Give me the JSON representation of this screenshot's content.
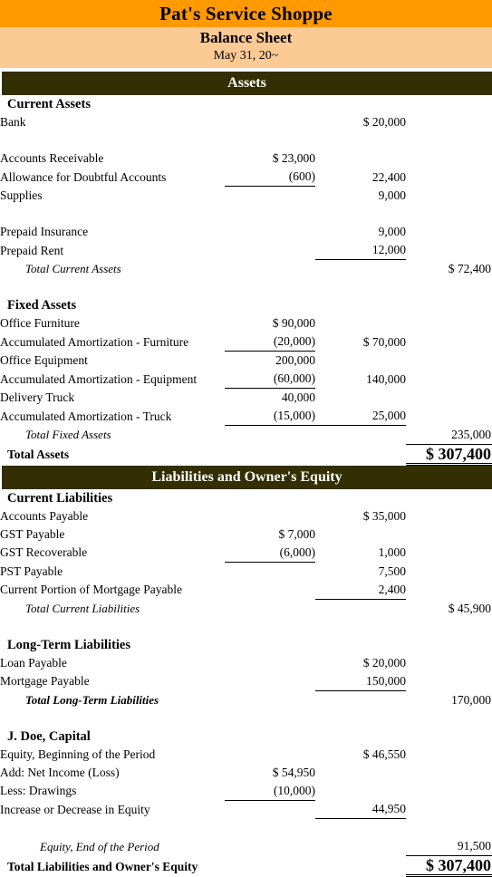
{
  "header": {
    "company": "Pat's Service Shoppe",
    "statement": "Balance Sheet",
    "date": "May 31, 20~"
  },
  "bands": {
    "assets": "Assets",
    "liabilities_equity": "Liabilities and Owner's Equity"
  },
  "colors": {
    "title_bar": "#FF9900",
    "subtitle_bar": "#FCCA95",
    "section_band": "#332F02",
    "band_text": "#FFFFFF",
    "text": "#000000"
  },
  "sections": {
    "current_assets": {
      "heading": "Current Assets",
      "rows": [
        {
          "label": "Bank",
          "c1": "",
          "c2": "$ 20,000",
          "c3": ""
        },
        {
          "label": "Accounts Receivable",
          "c1": "$ 23,000",
          "c2": "",
          "c3": ""
        },
        {
          "label": "Allowance for Doubtful Accounts",
          "c1": "(600)",
          "c2": "22,400",
          "c3": ""
        },
        {
          "label": "Supplies",
          "c1": "",
          "c2": "9,000",
          "c3": ""
        },
        {
          "label": "Prepaid Insurance",
          "c1": "",
          "c2": "9,000",
          "c3": ""
        },
        {
          "label": "Prepaid Rent",
          "c1": "",
          "c2": "12,000",
          "c3": ""
        }
      ],
      "total_label": "Total Current Assets",
      "total_value": "$ 72,400"
    },
    "fixed_assets": {
      "heading": "Fixed Assets",
      "rows": [
        {
          "label": "Office Furniture",
          "c1": "$ 90,000",
          "c2": "",
          "c3": ""
        },
        {
          "label": "Accumulated Amortization - Furniture",
          "c1": "(20,000)",
          "c2": "$ 70,000",
          "c3": ""
        },
        {
          "label": "Office Equipment",
          "c1": "200,000",
          "c2": "",
          "c3": ""
        },
        {
          "label": "Accumulated Amortization - Equipment",
          "c1": "(60,000)",
          "c2": "140,000",
          "c3": ""
        },
        {
          "label": "Delivery Truck",
          "c1": "40,000",
          "c2": "",
          "c3": ""
        },
        {
          "label": "Accumulated Amortization - Truck",
          "c1": "(15,000)",
          "c2": "25,000",
          "c3": ""
        }
      ],
      "total_label": "Total Fixed Assets",
      "total_value": "235,000"
    },
    "total_assets": {
      "label": "Total Assets",
      "value": "$ 307,400"
    },
    "current_liabilities": {
      "heading": "Current Liabilities",
      "rows": [
        {
          "label": "Accounts Payable",
          "c1": "",
          "c2": "$ 35,000",
          "c3": ""
        },
        {
          "label": "GST Payable",
          "c1": "$ 7,000",
          "c2": "",
          "c3": ""
        },
        {
          "label": "GST Recoverable",
          "c1": "(6,000)",
          "c2": "1,000",
          "c3": ""
        },
        {
          "label": "PST Payable",
          "c1": "",
          "c2": "7,500",
          "c3": ""
        },
        {
          "label": "Current Portion of Mortgage Payable",
          "c1": "",
          "c2": "2,400",
          "c3": ""
        }
      ],
      "total_label": "Total Current Liabilities",
      "total_value": "$ 45,900"
    },
    "long_term_liabilities": {
      "heading": "Long-Term Liabilities",
      "rows": [
        {
          "label": "Loan Payable",
          "c1": "",
          "c2": "$ 20,000",
          "c3": ""
        },
        {
          "label": "Mortgage Payable",
          "c1": "",
          "c2": "150,000",
          "c3": ""
        }
      ],
      "total_label": "Total Long-Term Liabilities",
      "total_value": "170,000"
    },
    "capital": {
      "heading": "J. Doe, Capital",
      "rows": [
        {
          "label": "Equity, Beginning of the Period",
          "c1": "",
          "c2": "$ 46,550",
          "c3": ""
        },
        {
          "label": "Add: Net Income (Loss)",
          "c1": "$ 54,950",
          "c2": "",
          "c3": ""
        },
        {
          "label": "Less: Drawings",
          "c1": "(10,000)",
          "c2": "",
          "c3": ""
        },
        {
          "label": "Increase or Decrease in Equity",
          "c1": "",
          "c2": "44,950",
          "c3": ""
        }
      ],
      "total_label": "Equity, End of the Period",
      "total_value": "91,500"
    },
    "total_liabilities_equity": {
      "label": "Total Liabilities and Owner's Equity",
      "value": "$ 307,400"
    }
  }
}
